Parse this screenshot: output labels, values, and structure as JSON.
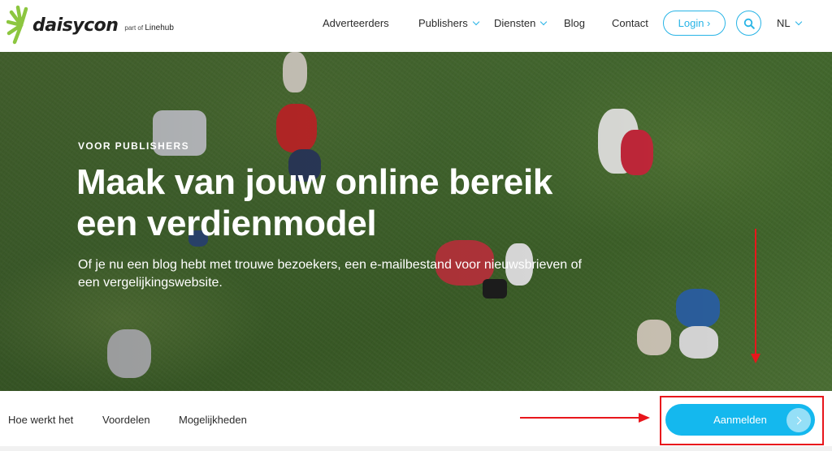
{
  "brand": {
    "name": "daisycon",
    "sub_prefix": "part of",
    "sub_name": "Linehub",
    "accent": "#27b4e6",
    "logo_green": "#8cc63f"
  },
  "nav": {
    "items": [
      {
        "label": "Adverteerders",
        "dropdown": false
      },
      {
        "label": "Publishers",
        "dropdown": true
      },
      {
        "label": "Diensten",
        "dropdown": true
      },
      {
        "label": "Blog",
        "dropdown": false
      },
      {
        "label": "Contact",
        "dropdown": false
      }
    ],
    "login_label": "Login ›",
    "search_icon": "search-icon",
    "language": "NL"
  },
  "hero": {
    "eyebrow": "VOOR PUBLISHERS",
    "headline": "Maak van jouw online bereik een verdienmodel",
    "subline": "Of je nu een blog hebt met trouwe bezoekers, een e-mailbestand voor nieuwsbrieven of een vergelijkingswebsite."
  },
  "subnav": {
    "items": [
      "Hoe werkt het",
      "Voordelen",
      "Mogelijkheden"
    ],
    "cta_label": "Aanmelden",
    "cta_color": "#14b8ee"
  },
  "annotation": {
    "color": "#e8161c"
  }
}
